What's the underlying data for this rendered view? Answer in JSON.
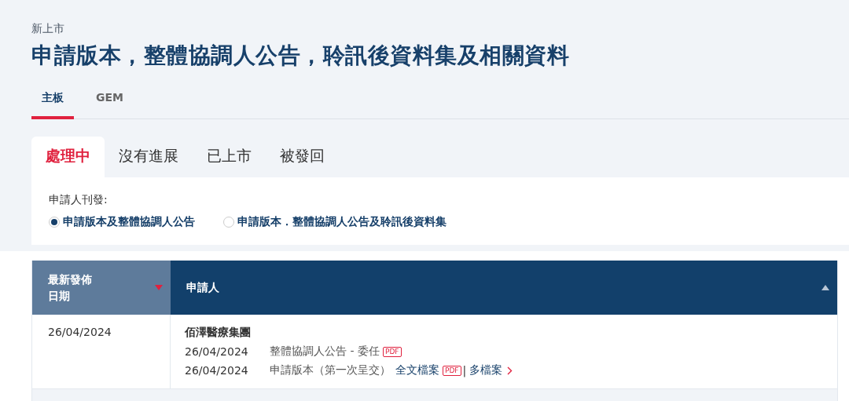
{
  "breadcrumb": "新上市",
  "title": "申請版本，整體協調人公告，聆訊後資料集及相關資料",
  "board_tabs": [
    {
      "label": "主板",
      "selected": true
    },
    {
      "label": "GEM",
      "selected": false
    }
  ],
  "status_tabs": [
    {
      "label": "處理中",
      "selected": true
    },
    {
      "label": "沒有進展",
      "selected": false
    },
    {
      "label": "已上市",
      "selected": false
    },
    {
      "label": "被發回",
      "selected": false
    }
  ],
  "filter": {
    "label": "申請人刊發:",
    "options": [
      {
        "label": "申請版本及整體協調人公告",
        "selected": true
      },
      {
        "label": "申請版本．整體協調人公告及聆訊後資料集",
        "selected": false
      }
    ]
  },
  "table": {
    "columns": [
      {
        "label": "最新發佈日期",
        "sort_active": true,
        "sort_descending": true
      },
      {
        "label": "申請人",
        "sort_active": false,
        "sort_descending": false
      }
    ],
    "rows": [
      {
        "date": "26/04/2024",
        "applicant": "佰澤醫療集團",
        "documents": [
          {
            "date": "26/04/2024",
            "title": "整體協調人公告 - 委任",
            "badge": "PDF"
          },
          {
            "date": "26/04/2024",
            "title": "申請版本（第一次呈交）",
            "file_link": "全文檔案",
            "badge": "PDF",
            "separator": "|",
            "more_link": "多檔案"
          }
        ]
      }
    ]
  }
}
